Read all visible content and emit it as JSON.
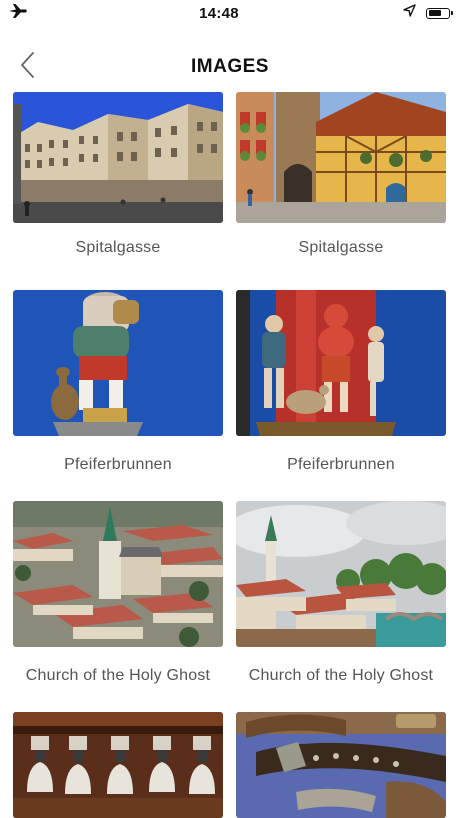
{
  "status_bar": {
    "time": "14:48",
    "left_icon": "airplane-icon",
    "right_icons": [
      "location-arrow-icon",
      "battery-icon"
    ],
    "battery_level": 0.7
  },
  "header": {
    "title": "IMAGES",
    "back_icon": "chevron-left-icon"
  },
  "gallery": {
    "items": [
      {
        "caption": "Spitalgasse",
        "image": "spitalgasse-street-photo"
      },
      {
        "caption": "Spitalgasse",
        "image": "spitalgasse-clock-tower-photo"
      },
      {
        "caption": "Pfeiferbrunnen",
        "image": "pfeiferbrunnen-statue-photo"
      },
      {
        "caption": "Pfeiferbrunnen",
        "image": "pfeiferbrunnen-column-photo"
      },
      {
        "caption": "Church of the Holy Ghost",
        "image": "holy-ghost-church-aerial-photo"
      },
      {
        "caption": "Church of the Holy Ghost",
        "image": "holy-ghost-church-river-photo"
      },
      {
        "caption": "",
        "image": "cowbells-photo"
      },
      {
        "caption": "",
        "image": "leather-straps-photo"
      }
    ]
  },
  "colors": {
    "text": "#222222",
    "caption": "#555555",
    "background": "#ffffff"
  }
}
